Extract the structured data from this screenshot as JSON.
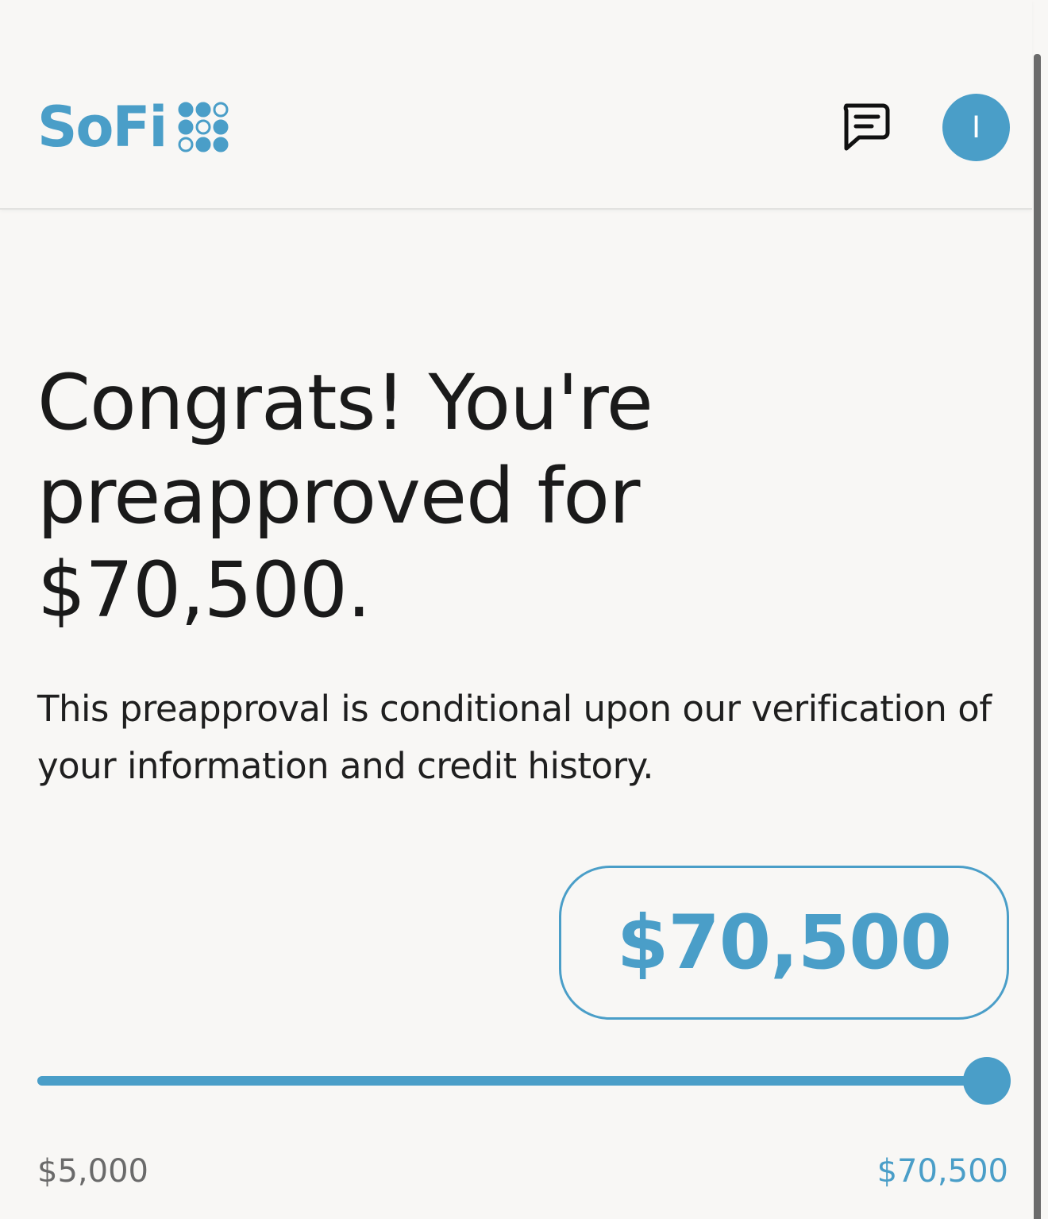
{
  "header": {
    "logo_text": "SoFi",
    "chat_icon": "chat-bubble-icon",
    "avatar_initial": "I"
  },
  "main": {
    "headline_lines": [
      "Congrats! You're",
      "preapproved for",
      "$70,500."
    ],
    "disclaimer_lines": [
      "This preapproval is conditional upon our verification of",
      "your information and credit history."
    ],
    "loan_amount": "$70,500",
    "slider": {
      "min_label": "$5,000",
      "max_label": "$70,500",
      "min": 5000,
      "max": 70500,
      "value": 70500
    }
  },
  "colors": {
    "brand": "#4a9ec8",
    "background": "#f8f7f5",
    "text": "#1a1a1a"
  }
}
